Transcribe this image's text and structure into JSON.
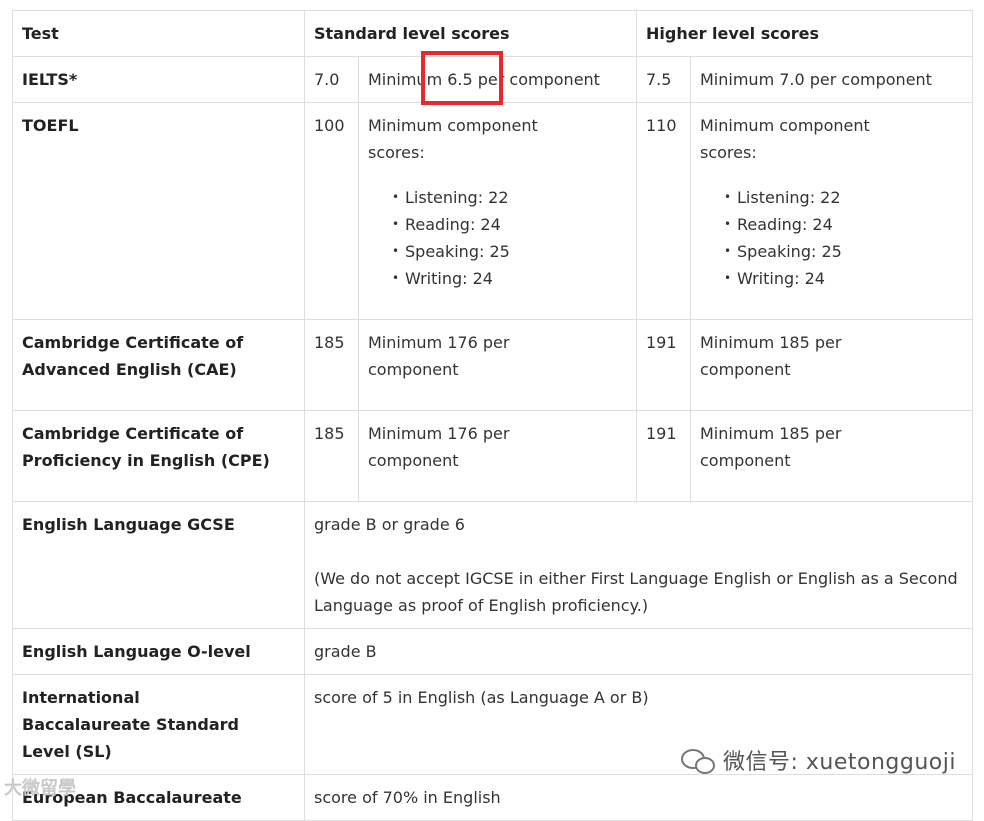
{
  "table": {
    "headers": [
      "Test",
      "Standard level scores",
      "Higher level scores"
    ],
    "rows": {
      "ielts": {
        "test": "IELTS*",
        "std_score": "7.0",
        "std_detail": "Minimum 6.5 per component",
        "high_score": "7.5",
        "high_detail": "Minimum 7.0 per component"
      },
      "toefl": {
        "test": "TOEFL",
        "std_score": "100",
        "std_detail": "Minimum component scores:",
        "std_list": [
          "Listening: 22",
          "Reading: 24",
          "Speaking: 25",
          "Writing: 24"
        ],
        "high_score": "110",
        "high_detail": "Minimum component scores:",
        "high_list": [
          "Listening: 22",
          "Reading: 24",
          "Speaking: 25",
          "Writing: 24"
        ]
      },
      "cae": {
        "test": "Cambridge Certificate of Advanced English (CAE)",
        "std_score": "185",
        "std_detail": "Minimum 176 per component",
        "high_score": "191",
        "high_detail": "Minimum 185 per component"
      },
      "cpe": {
        "test": "Cambridge Certificate of Proficiency in English (CPE)",
        "std_score": "185",
        "std_detail": "Minimum 176 per component",
        "high_score": "191",
        "high_detail": "Minimum 185 per component"
      },
      "gcse": {
        "test": "English Language GCSE",
        "detail": "grade B or grade 6",
        "note": "(We do not accept IGCSE in either First Language English or English as a Second Language as proof of English proficiency.)"
      },
      "olevel": {
        "test": "English Language O-level",
        "detail": "grade B"
      },
      "ib": {
        "test": "International Baccalaureate Standard Level (SL)",
        "detail": "score of 5 in English (as Language A or B)"
      },
      "eb": {
        "test": "European Baccalaureate",
        "detail": "score of 70% in English"
      }
    }
  },
  "watermark": {
    "right_text": "微信号: xuetongguoji",
    "left_text": "大微留學"
  },
  "colors": {
    "highlight": "#e8282f",
    "border": "#dedede",
    "text": "#333333"
  }
}
